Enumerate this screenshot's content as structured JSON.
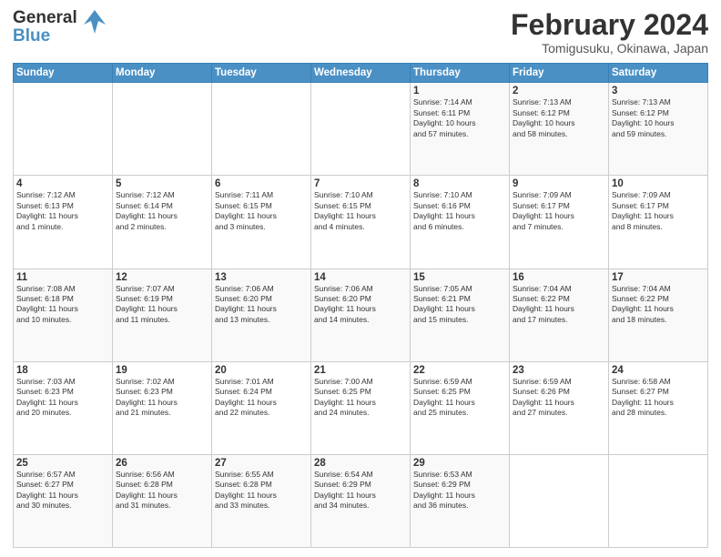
{
  "header": {
    "logo_line1": "General",
    "logo_line2": "Blue",
    "main_title": "February 2024",
    "subtitle": "Tomigusuku, Okinawa, Japan"
  },
  "days_of_week": [
    "Sunday",
    "Monday",
    "Tuesday",
    "Wednesday",
    "Thursday",
    "Friday",
    "Saturday"
  ],
  "weeks": [
    [
      {
        "day": "",
        "info": ""
      },
      {
        "day": "",
        "info": ""
      },
      {
        "day": "",
        "info": ""
      },
      {
        "day": "",
        "info": ""
      },
      {
        "day": "1",
        "info": "Sunrise: 7:14 AM\nSunset: 6:11 PM\nDaylight: 10 hours\nand 57 minutes."
      },
      {
        "day": "2",
        "info": "Sunrise: 7:13 AM\nSunset: 6:12 PM\nDaylight: 10 hours\nand 58 minutes."
      },
      {
        "day": "3",
        "info": "Sunrise: 7:13 AM\nSunset: 6:12 PM\nDaylight: 10 hours\nand 59 minutes."
      }
    ],
    [
      {
        "day": "4",
        "info": "Sunrise: 7:12 AM\nSunset: 6:13 PM\nDaylight: 11 hours\nand 1 minute."
      },
      {
        "day": "5",
        "info": "Sunrise: 7:12 AM\nSunset: 6:14 PM\nDaylight: 11 hours\nand 2 minutes."
      },
      {
        "day": "6",
        "info": "Sunrise: 7:11 AM\nSunset: 6:15 PM\nDaylight: 11 hours\nand 3 minutes."
      },
      {
        "day": "7",
        "info": "Sunrise: 7:10 AM\nSunset: 6:15 PM\nDaylight: 11 hours\nand 4 minutes."
      },
      {
        "day": "8",
        "info": "Sunrise: 7:10 AM\nSunset: 6:16 PM\nDaylight: 11 hours\nand 6 minutes."
      },
      {
        "day": "9",
        "info": "Sunrise: 7:09 AM\nSunset: 6:17 PM\nDaylight: 11 hours\nand 7 minutes."
      },
      {
        "day": "10",
        "info": "Sunrise: 7:09 AM\nSunset: 6:17 PM\nDaylight: 11 hours\nand 8 minutes."
      }
    ],
    [
      {
        "day": "11",
        "info": "Sunrise: 7:08 AM\nSunset: 6:18 PM\nDaylight: 11 hours\nand 10 minutes."
      },
      {
        "day": "12",
        "info": "Sunrise: 7:07 AM\nSunset: 6:19 PM\nDaylight: 11 hours\nand 11 minutes."
      },
      {
        "day": "13",
        "info": "Sunrise: 7:06 AM\nSunset: 6:20 PM\nDaylight: 11 hours\nand 13 minutes."
      },
      {
        "day": "14",
        "info": "Sunrise: 7:06 AM\nSunset: 6:20 PM\nDaylight: 11 hours\nand 14 minutes."
      },
      {
        "day": "15",
        "info": "Sunrise: 7:05 AM\nSunset: 6:21 PM\nDaylight: 11 hours\nand 15 minutes."
      },
      {
        "day": "16",
        "info": "Sunrise: 7:04 AM\nSunset: 6:22 PM\nDaylight: 11 hours\nand 17 minutes."
      },
      {
        "day": "17",
        "info": "Sunrise: 7:04 AM\nSunset: 6:22 PM\nDaylight: 11 hours\nand 18 minutes."
      }
    ],
    [
      {
        "day": "18",
        "info": "Sunrise: 7:03 AM\nSunset: 6:23 PM\nDaylight: 11 hours\nand 20 minutes."
      },
      {
        "day": "19",
        "info": "Sunrise: 7:02 AM\nSunset: 6:23 PM\nDaylight: 11 hours\nand 21 minutes."
      },
      {
        "day": "20",
        "info": "Sunrise: 7:01 AM\nSunset: 6:24 PM\nDaylight: 11 hours\nand 22 minutes."
      },
      {
        "day": "21",
        "info": "Sunrise: 7:00 AM\nSunset: 6:25 PM\nDaylight: 11 hours\nand 24 minutes."
      },
      {
        "day": "22",
        "info": "Sunrise: 6:59 AM\nSunset: 6:25 PM\nDaylight: 11 hours\nand 25 minutes."
      },
      {
        "day": "23",
        "info": "Sunrise: 6:59 AM\nSunset: 6:26 PM\nDaylight: 11 hours\nand 27 minutes."
      },
      {
        "day": "24",
        "info": "Sunrise: 6:58 AM\nSunset: 6:27 PM\nDaylight: 11 hours\nand 28 minutes."
      }
    ],
    [
      {
        "day": "25",
        "info": "Sunrise: 6:57 AM\nSunset: 6:27 PM\nDaylight: 11 hours\nand 30 minutes."
      },
      {
        "day": "26",
        "info": "Sunrise: 6:56 AM\nSunset: 6:28 PM\nDaylight: 11 hours\nand 31 minutes."
      },
      {
        "day": "27",
        "info": "Sunrise: 6:55 AM\nSunset: 6:28 PM\nDaylight: 11 hours\nand 33 minutes."
      },
      {
        "day": "28",
        "info": "Sunrise: 6:54 AM\nSunset: 6:29 PM\nDaylight: 11 hours\nand 34 minutes."
      },
      {
        "day": "29",
        "info": "Sunrise: 6:53 AM\nSunset: 6:29 PM\nDaylight: 11 hours\nand 36 minutes."
      },
      {
        "day": "",
        "info": ""
      },
      {
        "day": "",
        "info": ""
      }
    ]
  ]
}
